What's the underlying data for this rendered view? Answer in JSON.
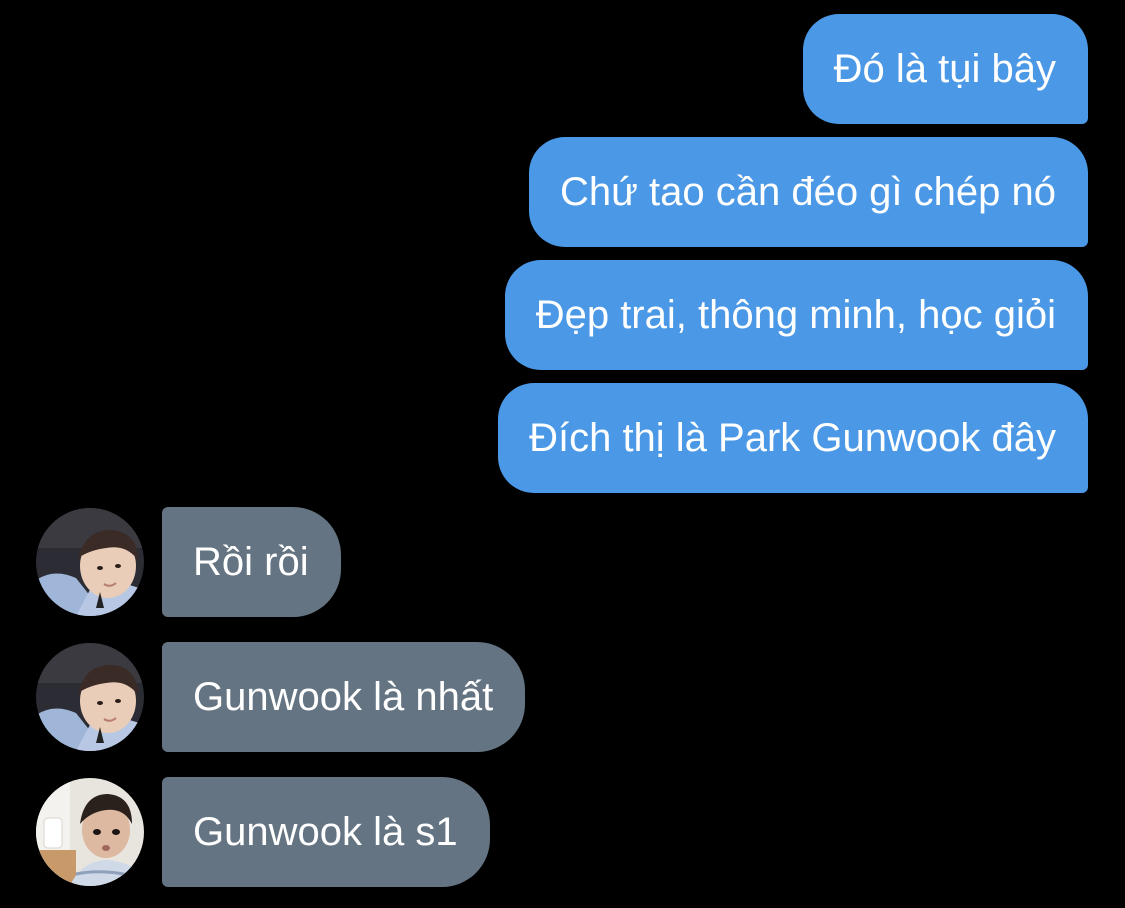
{
  "conversation": {
    "sent_messages": [
      {
        "text": "Đó là tụi bây"
      },
      {
        "text": "Chứ tao cần đéo gì chép nó"
      },
      {
        "text": "Đẹp trai, thông minh, học giỏi"
      },
      {
        "text": "Đích thị là Park Gunwook đây"
      }
    ],
    "received_messages": [
      {
        "text": "Rồi rồi",
        "avatar": "profile-photo-icon"
      },
      {
        "text": "Gunwook là nhất",
        "avatar": "profile-photo-icon"
      },
      {
        "text": "Gunwook là s1",
        "avatar": "profile-photo-icon"
      }
    ]
  },
  "colors": {
    "background": "#000000",
    "sent_bubble": "#4a98e6",
    "received_bubble": "#647482",
    "text": "#ffffff"
  }
}
